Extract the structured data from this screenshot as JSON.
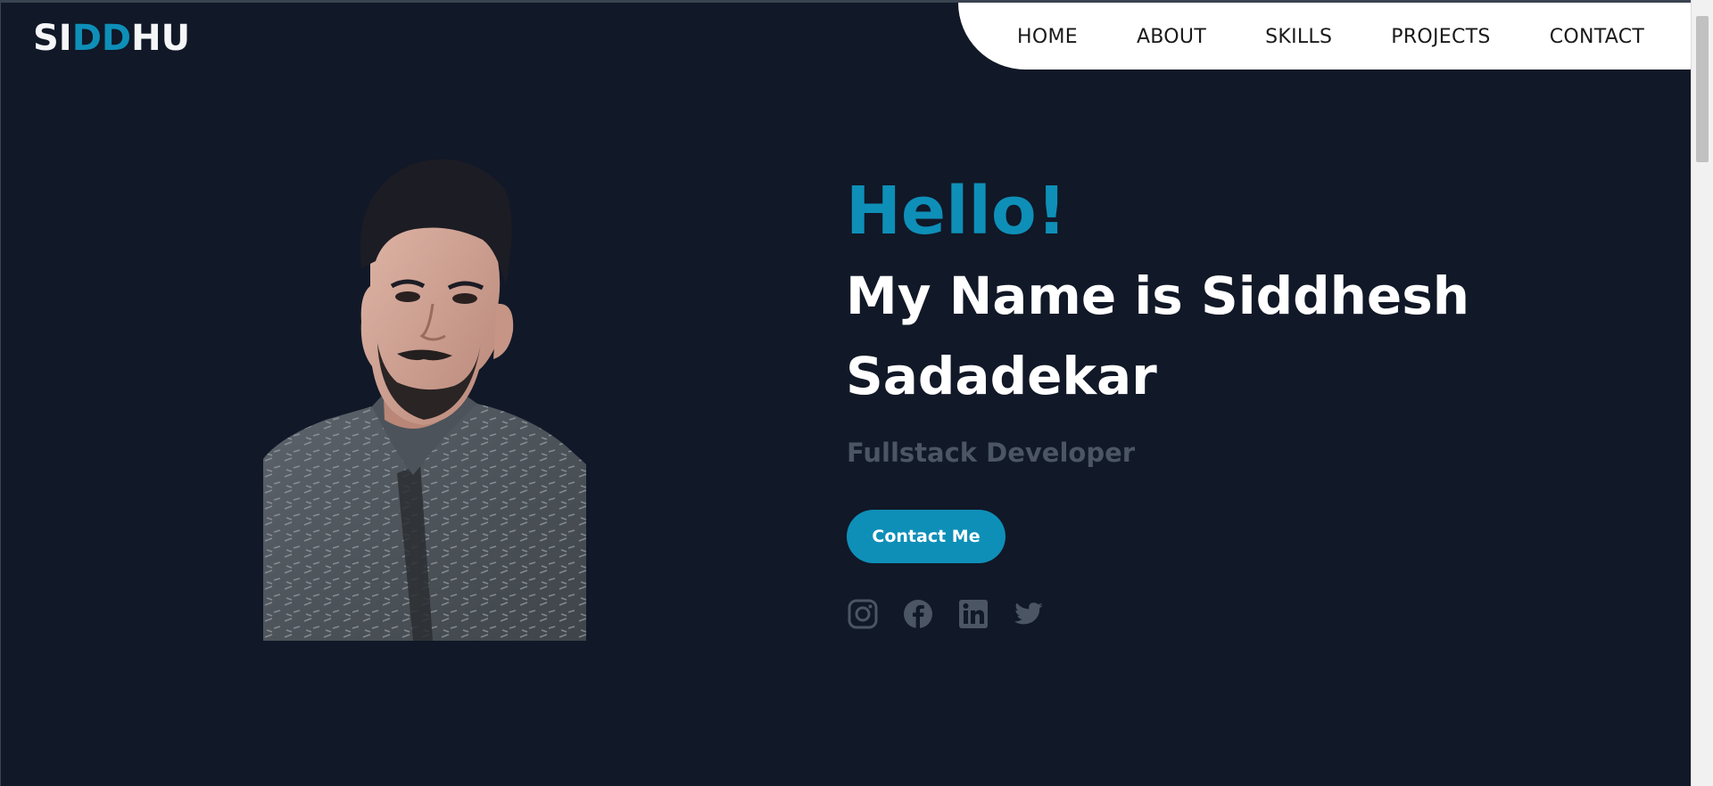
{
  "logo": {
    "part1": "SI",
    "part2": "DD",
    "part3": "HU"
  },
  "nav": {
    "items": [
      {
        "label": "HOME"
      },
      {
        "label": "ABOUT"
      },
      {
        "label": "SKILLS"
      },
      {
        "label": "PROJECTS"
      },
      {
        "label": "CONTACT"
      }
    ]
  },
  "hero": {
    "greeting": "Hello!",
    "name_line": "My Name is Siddhesh Sadadekar",
    "role": "Fullstack Developer",
    "contact_button": "Contact Me",
    "socials": [
      {
        "icon": "instagram-icon"
      },
      {
        "icon": "facebook-icon"
      },
      {
        "icon": "linkedin-icon"
      },
      {
        "icon": "twitter-icon"
      }
    ]
  },
  "colors": {
    "background": "#111827",
    "accent": "#0e8fb8",
    "muted": "#4b5563",
    "nav_background": "#ffffff"
  }
}
